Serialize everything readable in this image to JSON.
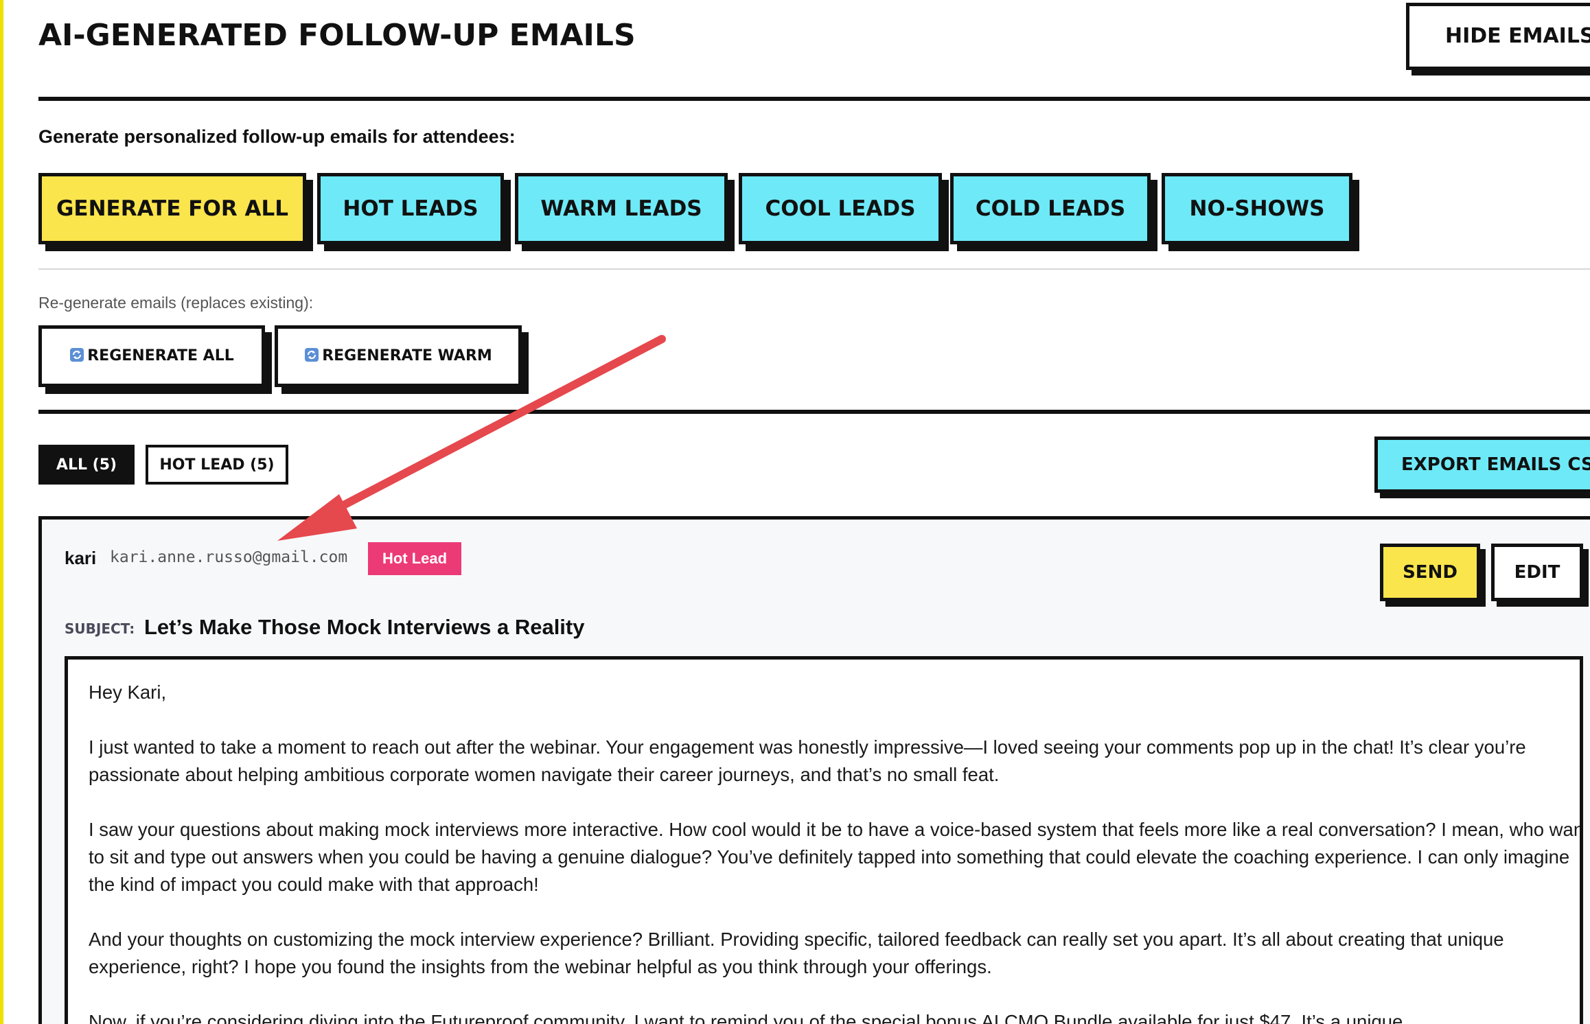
{
  "header": {
    "title": "AI-GENERATED FOLLOW-UP EMAILS",
    "hide_label": "HIDE EMAILS"
  },
  "generate": {
    "label": "Generate personalized follow-up emails for attendees:",
    "buttons": [
      {
        "label": "GENERATE FOR ALL"
      },
      {
        "label": "HOT LEADS"
      },
      {
        "label": "WARM LEADS"
      },
      {
        "label": "COOL LEADS"
      },
      {
        "label": "COLD LEADS"
      },
      {
        "label": "NO-SHOWS"
      }
    ]
  },
  "regenerate": {
    "label": "Re-generate emails (replaces existing):",
    "buttons": [
      {
        "label": "REGENERATE ALL",
        "icon": "refresh-icon"
      },
      {
        "label": "REGENERATE WARM",
        "icon": "refresh-icon"
      }
    ]
  },
  "filters": {
    "items": [
      {
        "label": "ALL (5)",
        "active": true
      },
      {
        "label": "HOT LEAD (5)",
        "active": false
      }
    ],
    "export_label": "EXPORT EMAILS CSV"
  },
  "email_card": {
    "name": "kari",
    "email": "kari.anne.russo@gmail.com",
    "badge": "Hot Lead",
    "badge_color": "#ec3a77",
    "send_label": "SEND",
    "edit_label": "EDIT",
    "subject_label": "SUBJECT:",
    "subject": "Let’s Make Those Mock Interviews a Reality",
    "body": [
      "Hey Kari,",
      "I just wanted to take a moment to reach out after the webinar. Your engagement was honestly impressive—I loved seeing your comments pop up in the chat! It’s clear you’re passionate about helping ambitious corporate women navigate their career journeys, and that’s no small feat.",
      "I saw your questions about making mock interviews more interactive. How cool would it be to have a voice-based system that feels more like a real conversation? I mean, who wants to sit and type out answers when you could be having a genuine dialogue? You’ve definitely tapped into something that could elevate the coaching experience. I can only imagine the kind of impact you could make with that approach!",
      "And your thoughts on customizing the mock interview experience? Brilliant. Providing specific, tailored feedback can really set you apart. It’s all about creating that unique experience, right? I hope you found the insights from the webinar helpful as you think through your offerings.",
      "Now, if you’re considering diving into the Futureproof community, I want to remind you of the special bonus AI CMO Bundle available for just $47. It’s a unique"
    ]
  },
  "colors": {
    "yellow": "#fbe54c",
    "cyan": "#6ee9f7",
    "hot_lead": "#ec3a77",
    "annotation_arrow": "#e5484d"
  }
}
